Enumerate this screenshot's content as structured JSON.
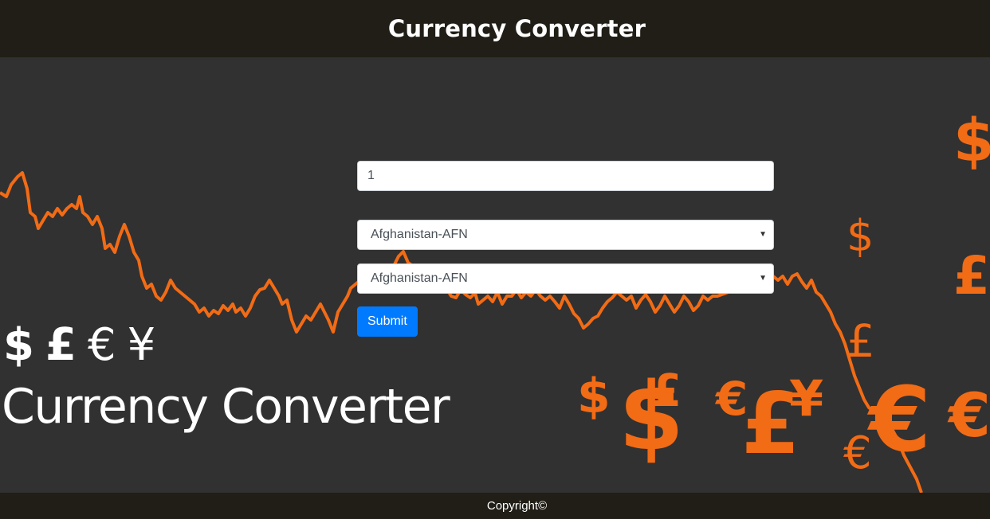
{
  "header": {
    "title": "Currency Converter"
  },
  "form": {
    "amount_value": "1",
    "from_currency": "Afghanistan-AFN",
    "to_currency": "Afghanistan-AFN",
    "submit_label": "Submit"
  },
  "promo": {
    "symbols": [
      "$",
      "£",
      "€",
      "¥"
    ],
    "title": "Currency Converter"
  },
  "background": {
    "line_color": "#f26b15",
    "decor_symbols": [
      "$",
      "$",
      "£",
      "$",
      "$",
      "£",
      "€",
      "£",
      "¥",
      "€",
      "€",
      "€",
      "€"
    ]
  },
  "footer": {
    "copyright": "Copyright©"
  },
  "colors": {
    "bar_bg": "#201e16",
    "page_bg": "#313131",
    "accent": "#f26b15",
    "button": "#007bff"
  }
}
